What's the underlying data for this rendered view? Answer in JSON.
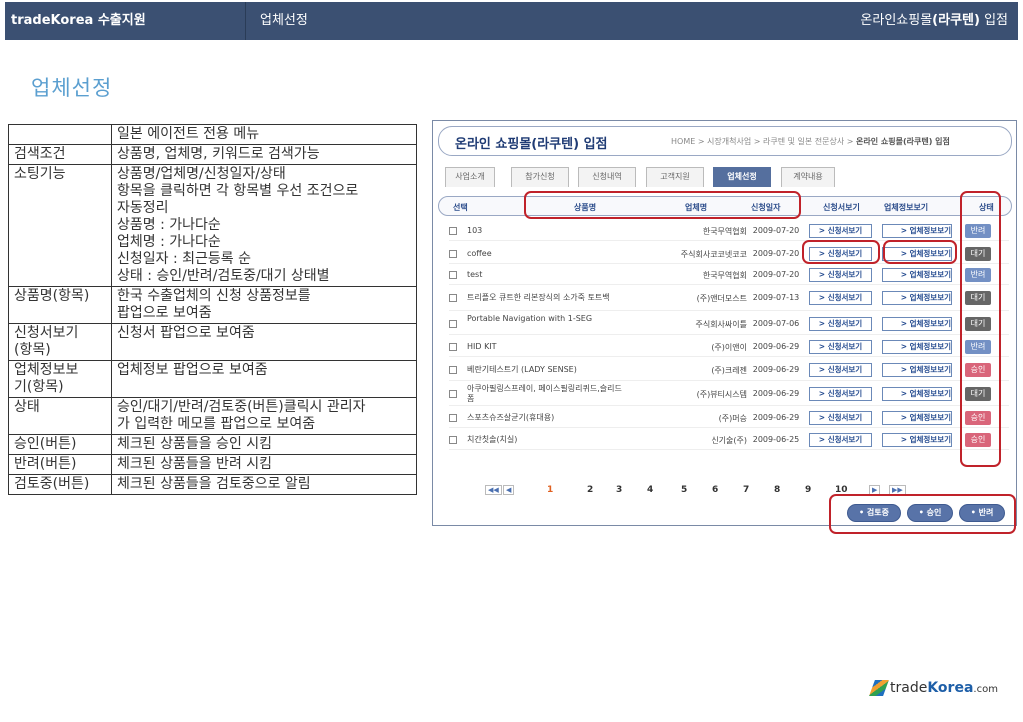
{
  "header": {
    "brand_bold": "tradeKorea",
    "brand_rest": " 수출지원",
    "section": "업체선정",
    "right_prefix": "온라인쇼핑몰",
    "right_bold": "(라쿠텐)",
    "right_suffix": " 입점"
  },
  "page_title": "업체선정",
  "spec_rows": [
    {
      "k": "",
      "v": "일본 에이전트 전용 메뉴"
    },
    {
      "k": "검색조건",
      "v": "상품명, 업체명, 키워드로 검색가능"
    },
    {
      "k": "소팅기능",
      "v": "상품명/업체명/신청일자/상태\n항목을 클릭하면 각 항목별 우선 조건으로\n자동정리\n상품명 : 가나다순\n업체명 : 가나다순\n신청일자 : 최근등록 순\n상태 : 승인/반려/검토중/대기 상태별"
    },
    {
      "k": "상품명(항목)",
      "v": "한국 수출업체의 신청 상품정보를\n팝업으로 보여줌"
    },
    {
      "k": "신청서보기\n(항목)",
      "v": "신청서 팝업으로 보여줌"
    },
    {
      "k": "업체정보보\n기(항목)",
      "v": "업체정보 팝업으로 보여줌"
    },
    {
      "k": "상태",
      "v": "승인/대기/반려/검토중(버튼)클릭시 관리자\n가 입력한 메모를 팝업으로 보여줌"
    },
    {
      "k": "승인(버튼)",
      "v": "체크된 상품들을 승인 시킴"
    },
    {
      "k": "반려(버튼)",
      "v": "체크된 상품들을 반려 시킴"
    },
    {
      "k": "검토중(버튼)",
      "v": "체크된 상품들을 검토중으로 알림"
    }
  ],
  "mock": {
    "title": "온라인 쇼핑몰(라쿠텐) 입점",
    "breadcrumb_prefix": "HOME > 시장개척사업 > 라쿠텐 및 일본 전문상사 > ",
    "breadcrumb_current": "온라인 쇼핑몰(라쿠텐) 입점",
    "tabs": [
      "사업소개",
      "참가신청",
      "신청내역",
      "고객지원",
      "업체선정",
      "계약내용"
    ],
    "columns": {
      "select": "선택",
      "product": "상품명",
      "company": "업체명",
      "date": "신청일자",
      "app": "신청서보기",
      "compinfo": "업체정보보기",
      "status": "상태"
    },
    "app_button": "> 신청서보기",
    "comp_button": "> 업체정보보기",
    "rows": [
      {
        "name": "103",
        "company": "한국무역협회",
        "date": "2009-07-20",
        "status": "반려"
      },
      {
        "name": "coffee",
        "company": "주식회사코코넷코코",
        "date": "2009-07-20",
        "status": "대기"
      },
      {
        "name": "test",
        "company": "한국무역협회",
        "date": "2009-07-20",
        "status": "반려"
      },
      {
        "name": "트리플오 큐트한 리본장식의 소가죽 토트백",
        "company": "(주)앤더모스트",
        "date": "2009-07-13",
        "status": "대기"
      },
      {
        "name": "Portable Navigation with 1-SEG",
        "company": "주식회사싸이틀",
        "date": "2009-07-06",
        "status": "대기"
      },
      {
        "name": "HID KIT",
        "company": "(주)이앤이",
        "date": "2009-06-29",
        "status": "반려"
      },
      {
        "name": "베란기테스트기 (LADY SENSE)",
        "company": "(주)크레젠",
        "date": "2009-06-29",
        "status": "승인"
      },
      {
        "name": "아쿠아필링스프레이, 페이스필링리퀴드,슬리드폼",
        "company": "(주)뷰티시스템",
        "date": "2009-06-29",
        "status": "대기"
      },
      {
        "name": "스포츠슈즈살균기(휴대용)",
        "company": "(주)머승",
        "date": "2009-06-29",
        "status": "승인"
      },
      {
        "name": "치간칫솔(치실)",
        "company": "신기술(주)",
        "date": "2009-06-25",
        "status": "승인"
      }
    ],
    "pages": [
      "1",
      "2",
      "3",
      "4",
      "5",
      "6",
      "7",
      "8",
      "9",
      "10"
    ],
    "pager_arrows": [
      "◀◀",
      "◀",
      "▶",
      "▶▶"
    ],
    "actions": [
      "• 검토중",
      "• 승인",
      "• 반려"
    ]
  },
  "status_colors": {
    "반려": "#7390c4",
    "대기": "#666666",
    "승인": "#d9657a"
  },
  "accent": "#3b5072",
  "footer_logo": {
    "trade": "trade",
    "korea": "Korea",
    "com": ".com"
  }
}
